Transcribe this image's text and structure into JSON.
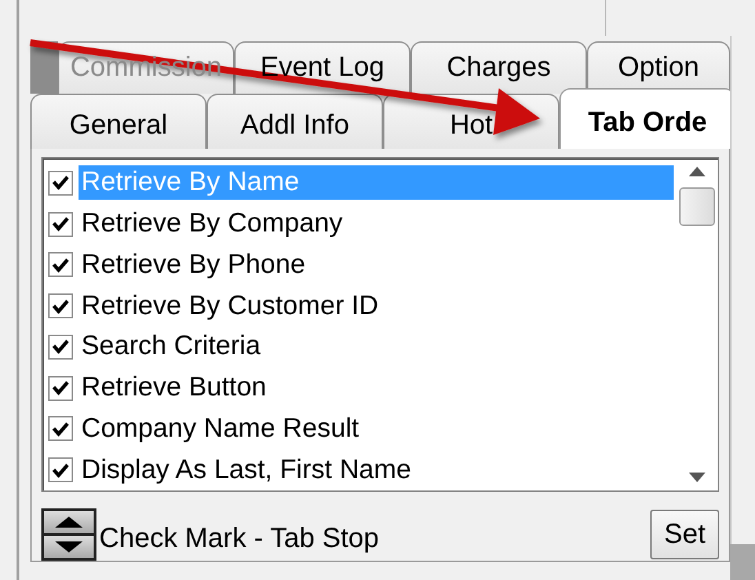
{
  "tab_rows": [
    [
      {
        "label": "Commission",
        "selected": false,
        "disabled": true
      },
      {
        "label": "Event Log",
        "selected": false,
        "disabled": false
      },
      {
        "label": "Charges",
        "selected": false,
        "disabled": false
      },
      {
        "label": "Option",
        "selected": false,
        "disabled": false
      }
    ],
    [
      {
        "label": "General",
        "selected": false,
        "disabled": false
      },
      {
        "label": "Addl Info",
        "selected": false,
        "disabled": false
      },
      {
        "label": "Hot",
        "selected": false,
        "disabled": false
      },
      {
        "label": "Tab Orde",
        "selected": true,
        "disabled": false
      }
    ]
  ],
  "items": [
    {
      "label": "Retrieve By Name",
      "checked": true,
      "selected": true
    },
    {
      "label": "Retrieve By Company",
      "checked": true,
      "selected": false
    },
    {
      "label": "Retrieve By Phone",
      "checked": true,
      "selected": false
    },
    {
      "label": "Retrieve By Customer ID",
      "checked": true,
      "selected": false
    },
    {
      "label": "Search Criteria",
      "checked": true,
      "selected": false
    },
    {
      "label": "Retrieve Button",
      "checked": true,
      "selected": false
    },
    {
      "label": "Company Name Result",
      "checked": true,
      "selected": false
    },
    {
      "label": "Display As Last, First Name",
      "checked": true,
      "selected": false
    }
  ],
  "legend": "Check Mark - Tab Stop",
  "set_button": "Set"
}
